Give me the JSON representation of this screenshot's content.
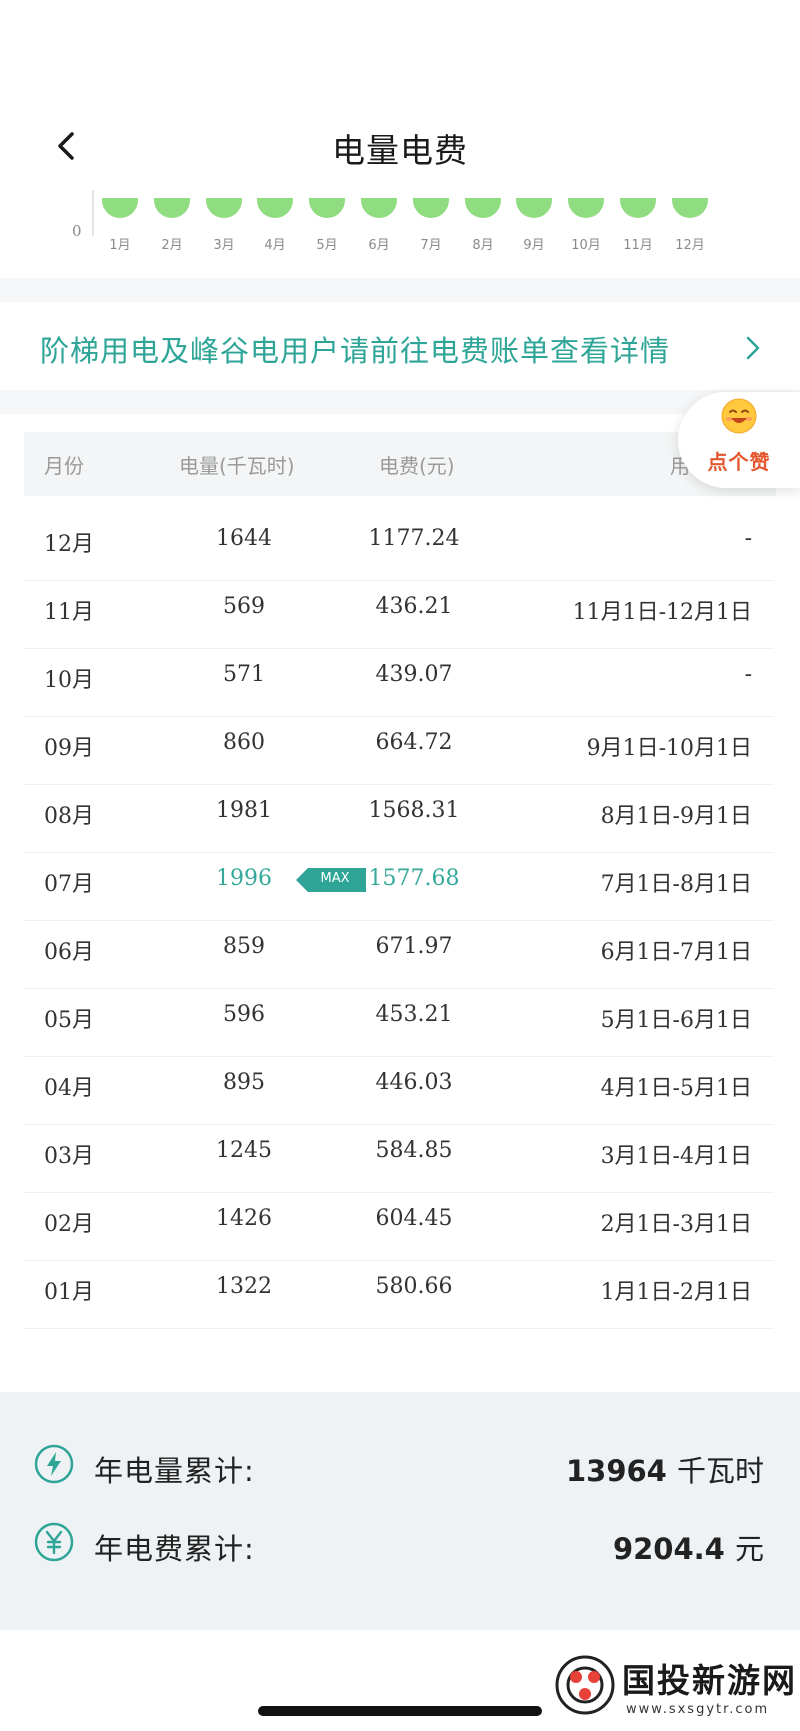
{
  "header": {
    "title": "电量电费"
  },
  "chart": {
    "zero_label": "0",
    "bar_color": "#8fdc81",
    "months": [
      "1月",
      "2月",
      "3月",
      "4月",
      "5月",
      "6月",
      "7月",
      "8月",
      "9月",
      "10月",
      "11月",
      "12月"
    ]
  },
  "notice": {
    "text": "阶梯用电及峰谷电用户请前往电费账单查看详情",
    "color": "#2ea597"
  },
  "like_button": {
    "label": "点个赞"
  },
  "table": {
    "headers": {
      "month": "月份",
      "kwh": "电量(千瓦时)",
      "fee": "电费(元)",
      "period": "用"
    },
    "max_badge": "MAX",
    "rows": [
      {
        "month": "12月",
        "kwh": "1644",
        "fee": "1177.24",
        "period": "-"
      },
      {
        "month": "11月",
        "kwh": "569",
        "fee": "436.21",
        "period": "11月1日-12月1日"
      },
      {
        "month": "10月",
        "kwh": "571",
        "fee": "439.07",
        "period": "-"
      },
      {
        "month": "09月",
        "kwh": "860",
        "fee": "664.72",
        "period": "9月1日-10月1日"
      },
      {
        "month": "08月",
        "kwh": "1981",
        "fee": "1568.31",
        "period": "8月1日-9月1日"
      },
      {
        "month": "07月",
        "kwh": "1996",
        "fee": "1577.68",
        "period": "7月1日-8月1日",
        "max": true
      },
      {
        "month": "06月",
        "kwh": "859",
        "fee": "671.97",
        "period": "6月1日-7月1日"
      },
      {
        "month": "05月",
        "kwh": "596",
        "fee": "453.21",
        "period": "5月1日-6月1日"
      },
      {
        "month": "04月",
        "kwh": "895",
        "fee": "446.03",
        "period": "4月1日-5月1日"
      },
      {
        "month": "03月",
        "kwh": "1245",
        "fee": "584.85",
        "period": "3月1日-4月1日"
      },
      {
        "month": "02月",
        "kwh": "1426",
        "fee": "604.45",
        "period": "2月1日-3月1日"
      },
      {
        "month": "01月",
        "kwh": "1322",
        "fee": "580.66",
        "period": "1月1日-2月1日"
      }
    ]
  },
  "summary": {
    "kwh_label": "年电量累计:",
    "kwh_value": "13964",
    "kwh_unit": "千瓦时",
    "fee_label": "年电费累计:",
    "fee_value": "9204.4",
    "fee_unit": "元",
    "icon_color": "#2ea597"
  },
  "watermark": {
    "title": "国投新游网",
    "url": "www.sxsgytr.com"
  }
}
